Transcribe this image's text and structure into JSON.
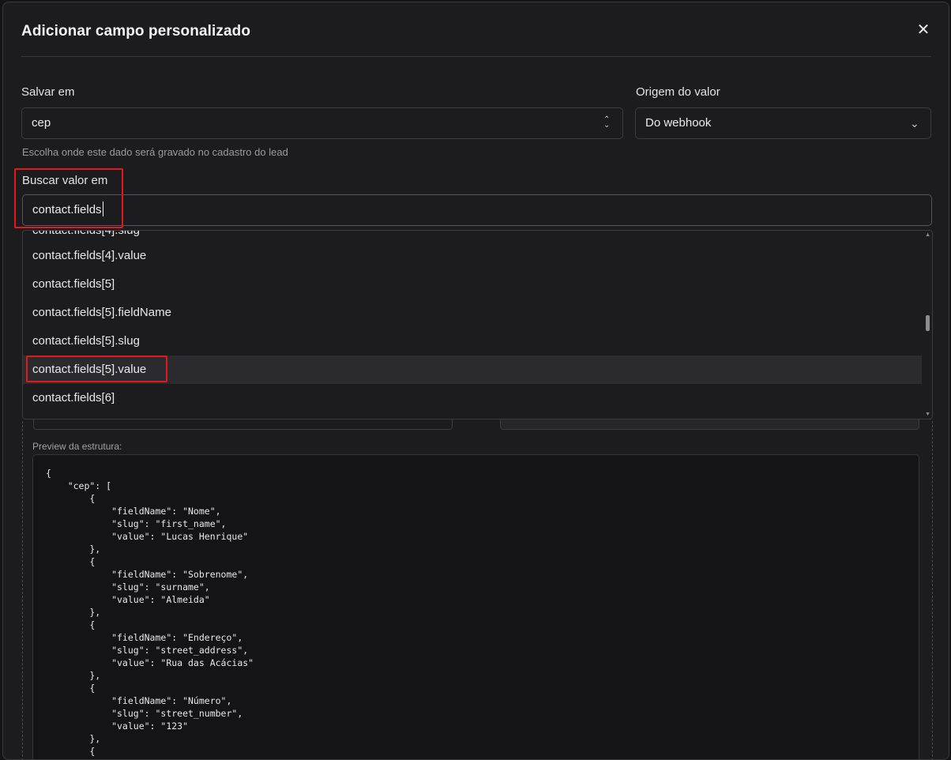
{
  "dialog": {
    "title": "Adicionar campo personalizado"
  },
  "save_in": {
    "label": "Salvar em",
    "value": "cep",
    "hint": "Escolha onde este dado será gravado no cadastro do lead"
  },
  "value_origin": {
    "label": "Origem do valor",
    "value": "Do webhook"
  },
  "search": {
    "label": "Buscar valor em",
    "value": "contact.fields"
  },
  "suggestions": [
    "contact.fields[4].value",
    "contact.fields[5]",
    "contact.fields[5].fieldName",
    "contact.fields[5].slug",
    "contact.fields[5].value",
    "contact.fields[6]"
  ],
  "selected_suggestion": "contact.fields[5].value",
  "preview": {
    "label": "Preview da estrutura:",
    "code": "{\n    \"cep\": [\n        {\n            \"fieldName\": \"Nome\",\n            \"slug\": \"first_name\",\n            \"value\": \"Lucas Henrique\"\n        },\n        {\n            \"fieldName\": \"Sobrenome\",\n            \"slug\": \"surname\",\n            \"value\": \"Almeida\"\n        },\n        {\n            \"fieldName\": \"Endereço\",\n            \"slug\": \"street_address\",\n            \"value\": \"Rua das Acácias\"\n        },\n        {\n            \"fieldName\": \"Número\",\n            \"slug\": \"street_number\",\n            \"value\": \"123\"\n        },\n        {"
  },
  "icons": {
    "close": "close-icon",
    "save_in_select": "chevron-up-down-icon",
    "origin_select": "chevron-down-icon"
  },
  "colors": {
    "background": "#1c1c1f",
    "border": "#3b3b40",
    "highlight_annotation": "#e01a1a",
    "selected_row": "#2b2b2f"
  }
}
